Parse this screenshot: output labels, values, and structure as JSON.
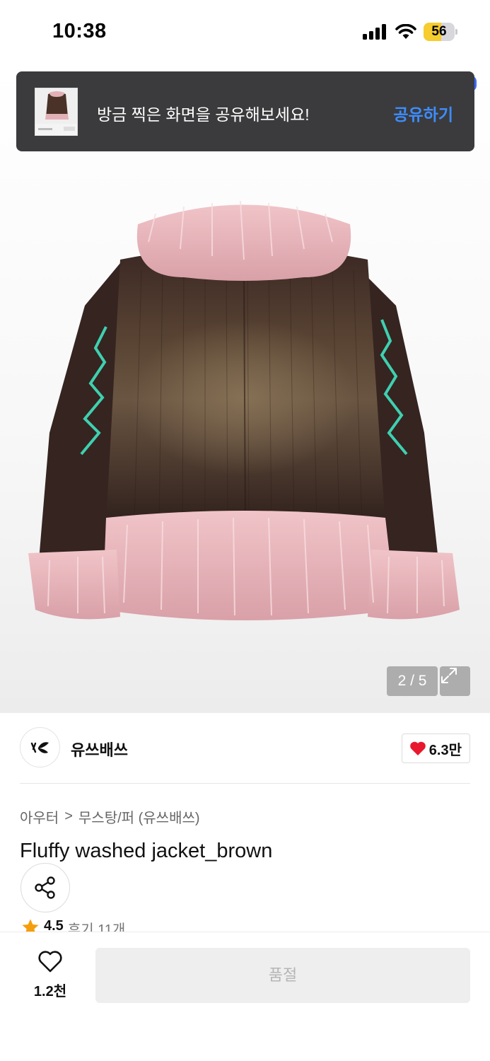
{
  "status_bar": {
    "time": "10:38",
    "battery": "56",
    "battery_level": 0.56
  },
  "toast": {
    "message": "방금 찍은 화면을 공유해보세요!",
    "action": "공유하기"
  },
  "gallery": {
    "counter": "2 / 5",
    "current": 2,
    "total": 5
  },
  "brand": {
    "name": "유쓰배쓰",
    "likes": "6.3만"
  },
  "breadcrumb": {
    "category": "아우터",
    "separator": ">",
    "subcategory": "무스탕/퍼 (유쓰배쓰)"
  },
  "product": {
    "title": "Fluffy washed jacket_brown",
    "rating": "4.5",
    "reviews": "후기 11개"
  },
  "bottom_bar": {
    "wish_count": "1.2천",
    "buy_label": "품절"
  },
  "colors": {
    "accent_blue": "#3d8dff",
    "heart_red": "#e8192c",
    "star_orange": "#f59e0b",
    "jacket_brown": "#3f2b24",
    "fur_pink": "#e8b4bb",
    "embroidery": "#3fd0b0"
  },
  "icons": [
    "signal-icon",
    "wifi-icon",
    "battery-icon",
    "expand-icon",
    "heart-icon",
    "share-icon",
    "star-icon",
    "chevron-right-icon"
  ]
}
